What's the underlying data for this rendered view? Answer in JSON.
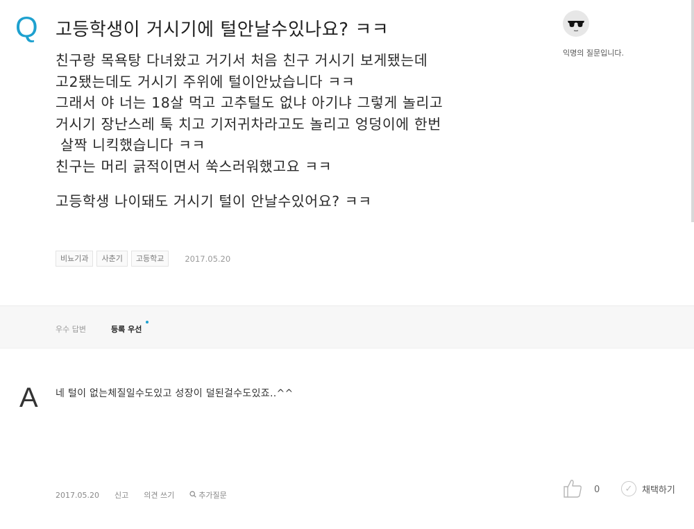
{
  "question": {
    "mark": "Q",
    "title": "고등학생이 거시기에 털안날수있나요? ㅋㅋ",
    "body_lines": [
      "친구랑 목욕탕 다녀왔고 거기서 처음 친구 거시기 보게됐는데",
      "고2됐는데도 거시기 주위에 털이안났습니다 ㅋㅋ",
      "그래서 야 너는 18살 먹고 고추털도 없냐 아기냐 그렇게 놀리고",
      "거시기 장난스레 툭 치고 기저귀차라고도 놀리고 엉덩이에 한번",
      " 살짝 니킥했습니다 ㅋㅋ",
      "친구는 머리 긁적이면서 쑥스러워했고요 ㅋㅋ"
    ],
    "closing_line": "고등학생 나이돼도 거시기 털이 안날수있어요? ㅋㅋ",
    "tags": [
      "비뇨기과",
      "사춘기",
      "고등학교"
    ],
    "date": "2017.05.20"
  },
  "asker": {
    "label": "익명의 질문입니다.",
    "avatar_icon": "anonymous-sunglasses-icon"
  },
  "sort": {
    "tabs": [
      "우수 답변",
      "등록 우선"
    ],
    "active": "등록 우선"
  },
  "answer": {
    "mark": "A",
    "text": "네 털이 없는체질일수도있고 성장이 덜된걸수도있죠..^^",
    "date": "2017.05.20",
    "report": "신고",
    "comment": "의견 쓰기",
    "followup": "추가질문",
    "like_count": "0",
    "adopt": "채택하기"
  },
  "colors": {
    "accent": "#1ea1cf",
    "sort_bar_bg": "#f7f7f7"
  }
}
